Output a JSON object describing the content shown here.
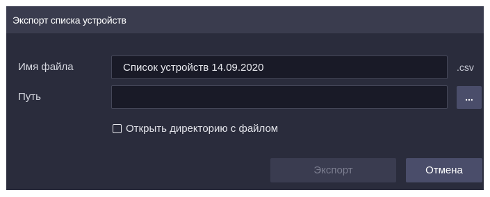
{
  "window": {
    "title": "Экспорт списка устройств"
  },
  "form": {
    "filename_label": "Имя файла",
    "filename_value": "Список устройств 14.09.2020",
    "extension": ".csv",
    "path_label": "Путь",
    "path_value": "",
    "browse_label": "...",
    "open_dir_label": "Открыть директорию с файлом",
    "open_dir_checked": false
  },
  "buttons": {
    "export_label": "Экспорт",
    "export_enabled": false,
    "cancel_label": "Отмена"
  },
  "colors": {
    "dialog_bg": "#2a2c3c",
    "titlebar_bg": "#3a3c4e",
    "field_bg": "#191a27",
    "accent_button": "#4a4d6a"
  }
}
